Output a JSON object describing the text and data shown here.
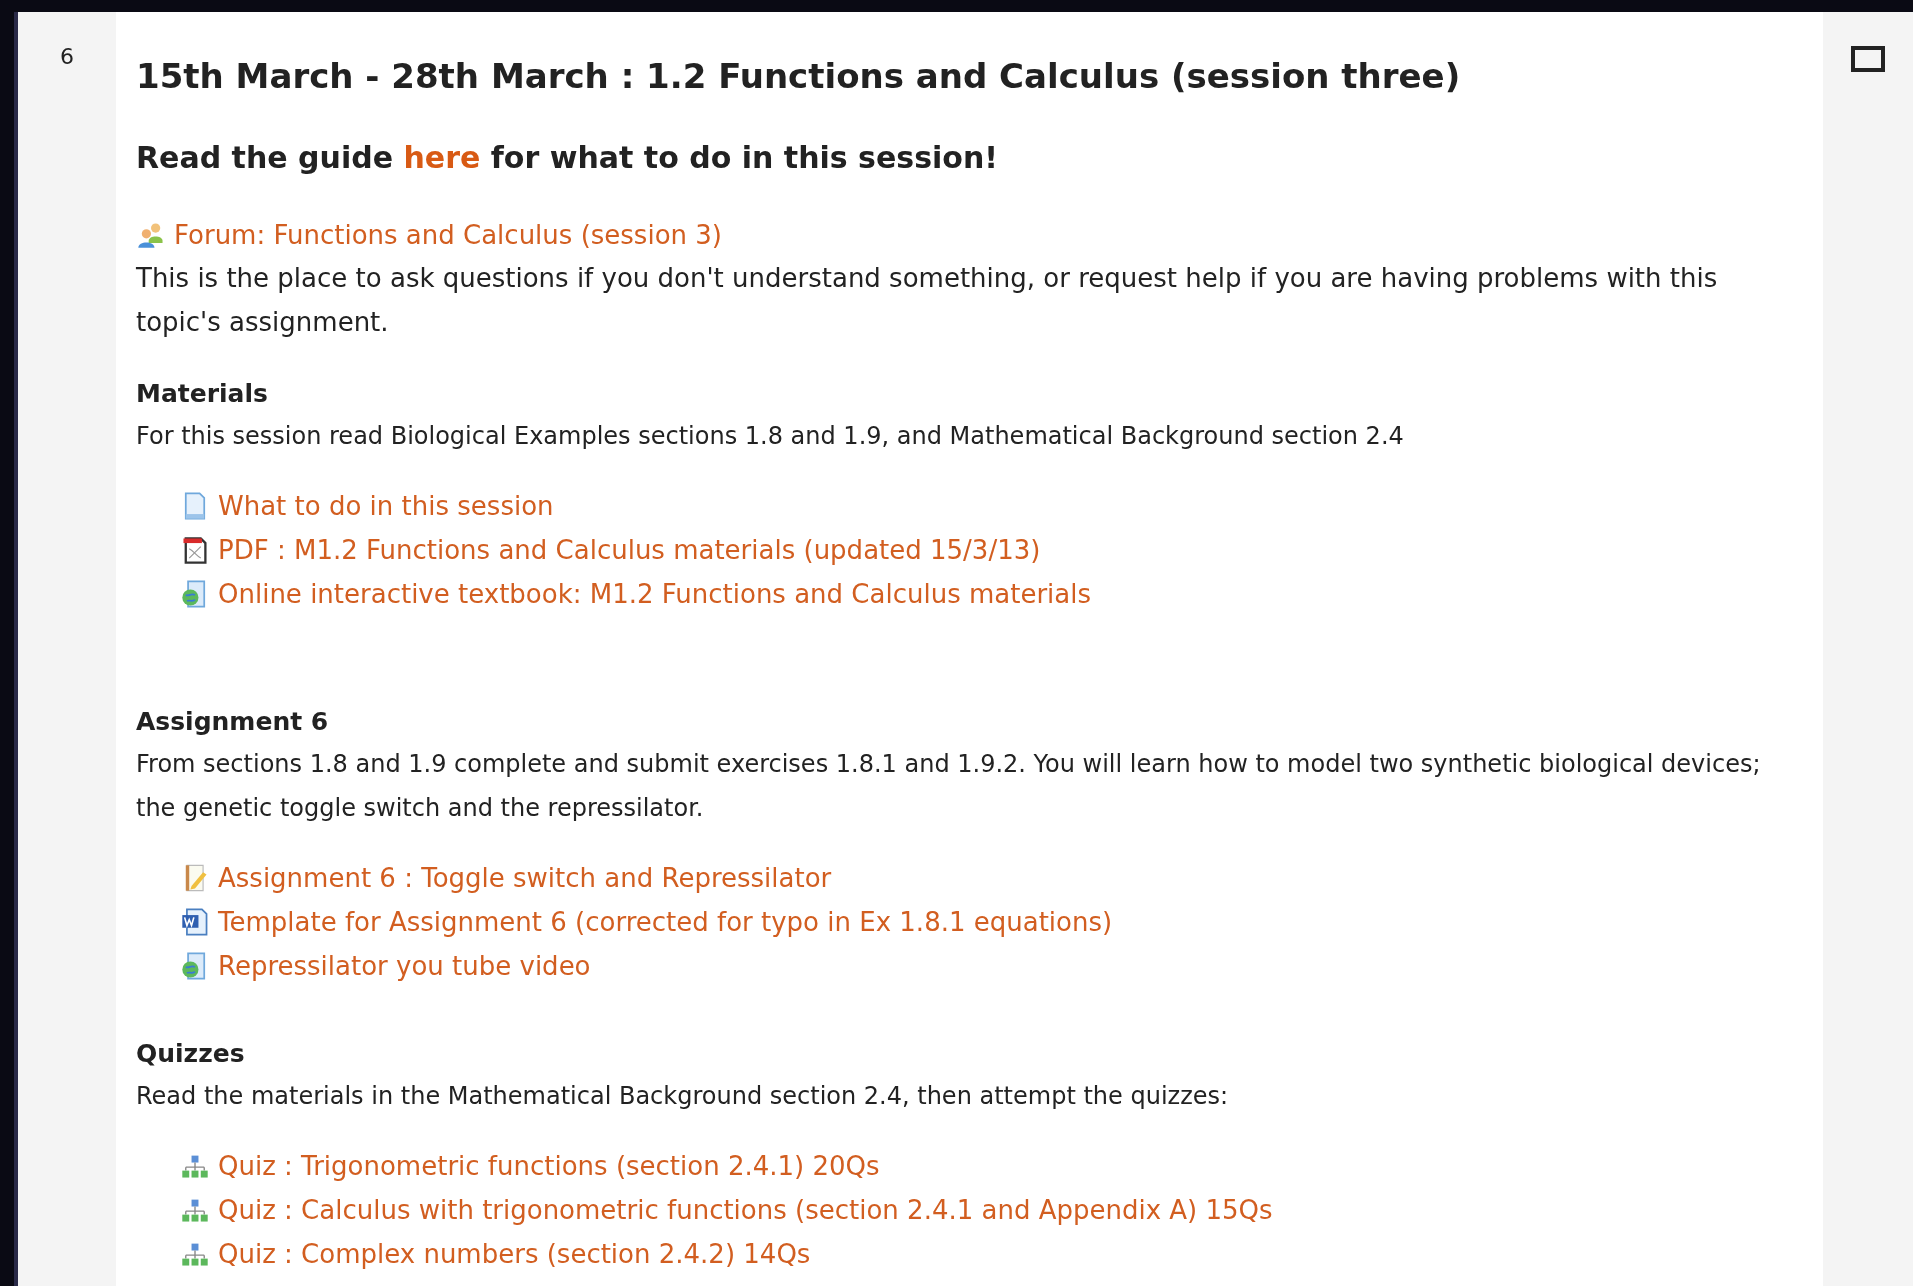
{
  "section": {
    "number": "6",
    "title": "15th March - 28th March : 1.2 Functions and Calculus (session three)",
    "guide": {
      "before": "Read the guide ",
      "link": "here",
      "after": " for what to do in this session!"
    },
    "forum": {
      "kind": "forum",
      "label": "Forum: Functions and Calculus (session 3)",
      "description": "This is the place to ask questions if you don't understand something, or request help if you are having problems with this topic's assignment."
    },
    "blocks": [
      {
        "heading": "Materials",
        "text": "For this session read Biological Examples sections 1.8 and 1.9, and Mathematical Background section 2.4",
        "links": [
          {
            "kind": "page",
            "label": "What to do in this session"
          },
          {
            "kind": "pdf",
            "label": "PDF : M1.2 Functions and Calculus materials (updated 15/3/13)"
          },
          {
            "kind": "url",
            "label": "Online interactive textbook: M1.2 Functions and Calculus materials"
          }
        ]
      },
      {
        "heading": "Assignment 6",
        "text": "From sections 1.8 and 1.9 complete and submit exercises 1.8.1 and 1.9.2. You will learn how to model two synthetic biological devices; the genetic toggle switch and the repressilator.",
        "links": [
          {
            "kind": "assignment",
            "label": "Assignment 6 : Toggle switch and Repressilator"
          },
          {
            "kind": "doc",
            "label": "Template for Assignment 6 (corrected for typo in Ex 1.8.1 equations)"
          },
          {
            "kind": "url",
            "label": "Repressilator you tube video"
          }
        ]
      },
      {
        "heading": "Quizzes",
        "text": "Read the materials in the Mathematical Background section 2.4, then attempt the quizzes:",
        "links": [
          {
            "kind": "quiz",
            "label": "Quiz : Trigonometric functions (section 2.4.1) 20Qs"
          },
          {
            "kind": "quiz",
            "label": "Quiz : Calculus with trigonometric functions (section 2.4.1 and Appendix A) 15Qs"
          },
          {
            "kind": "quiz",
            "label": "Quiz : Complex numbers (section 2.4.2) 14Qs"
          }
        ]
      }
    ]
  }
}
